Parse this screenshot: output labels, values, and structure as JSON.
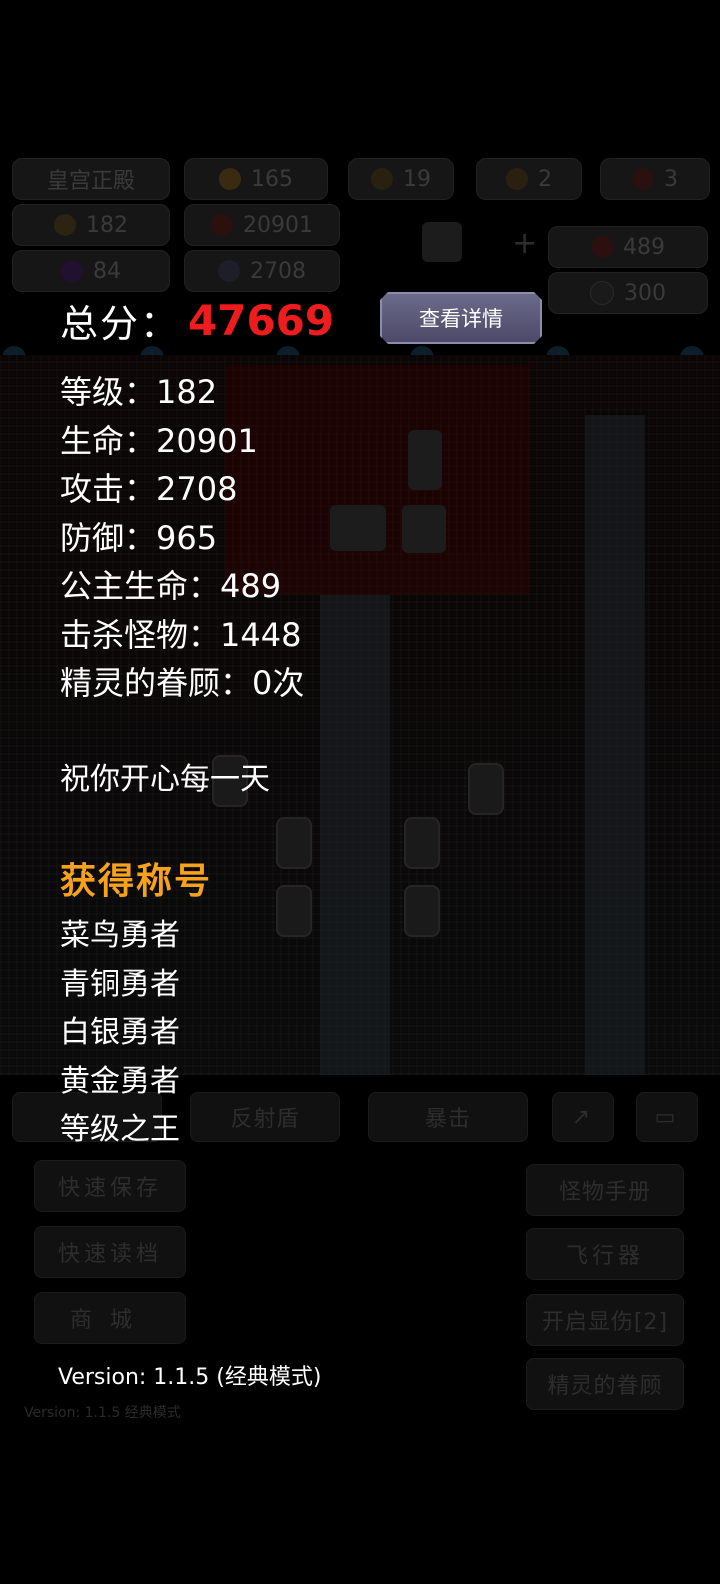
{
  "background": {
    "location": "皇宫正殿",
    "gold": "165",
    "key1": "19",
    "key2": "2",
    "key3": "3",
    "level": "182",
    "hp": "20901",
    "def": "84",
    "atk": "2708",
    "princess_hp": "489",
    "shield": "300",
    "track_nodes": [
      "0",
      "1",
      "2",
      "3",
      "4",
      "5"
    ],
    "skills": [
      "反射盾",
      "暴击"
    ],
    "left_buttons": [
      "快速保存",
      "快速读档",
      "商城"
    ],
    "right_buttons": [
      "怪物手册",
      "飞行器",
      "开启显伤[2]",
      "精灵的眷顾"
    ],
    "small_version": "Version: 1.1.5 经典模式"
  },
  "overlay": {
    "score_label": "总分：",
    "score_value": "47669",
    "detail_button": "查看详情",
    "stats": [
      "等级：182",
      "生命：20901",
      "攻击：2708",
      "防御：965",
      "公主生命：489",
      "击杀怪物：1448",
      "精灵的眷顾：0次"
    ],
    "wish": "祝你开心每一天",
    "titles_heading": "获得称号",
    "titles": [
      "菜鸟勇者",
      "青铜勇者",
      "白银勇者",
      "黄金勇者",
      "等级之王"
    ],
    "version": "Version: 1.1.5 (经典模式)"
  },
  "colors": {
    "score": "#ee1c1c",
    "titles_heading": "#f7a21b",
    "button_bg": "#5c5a7a"
  }
}
